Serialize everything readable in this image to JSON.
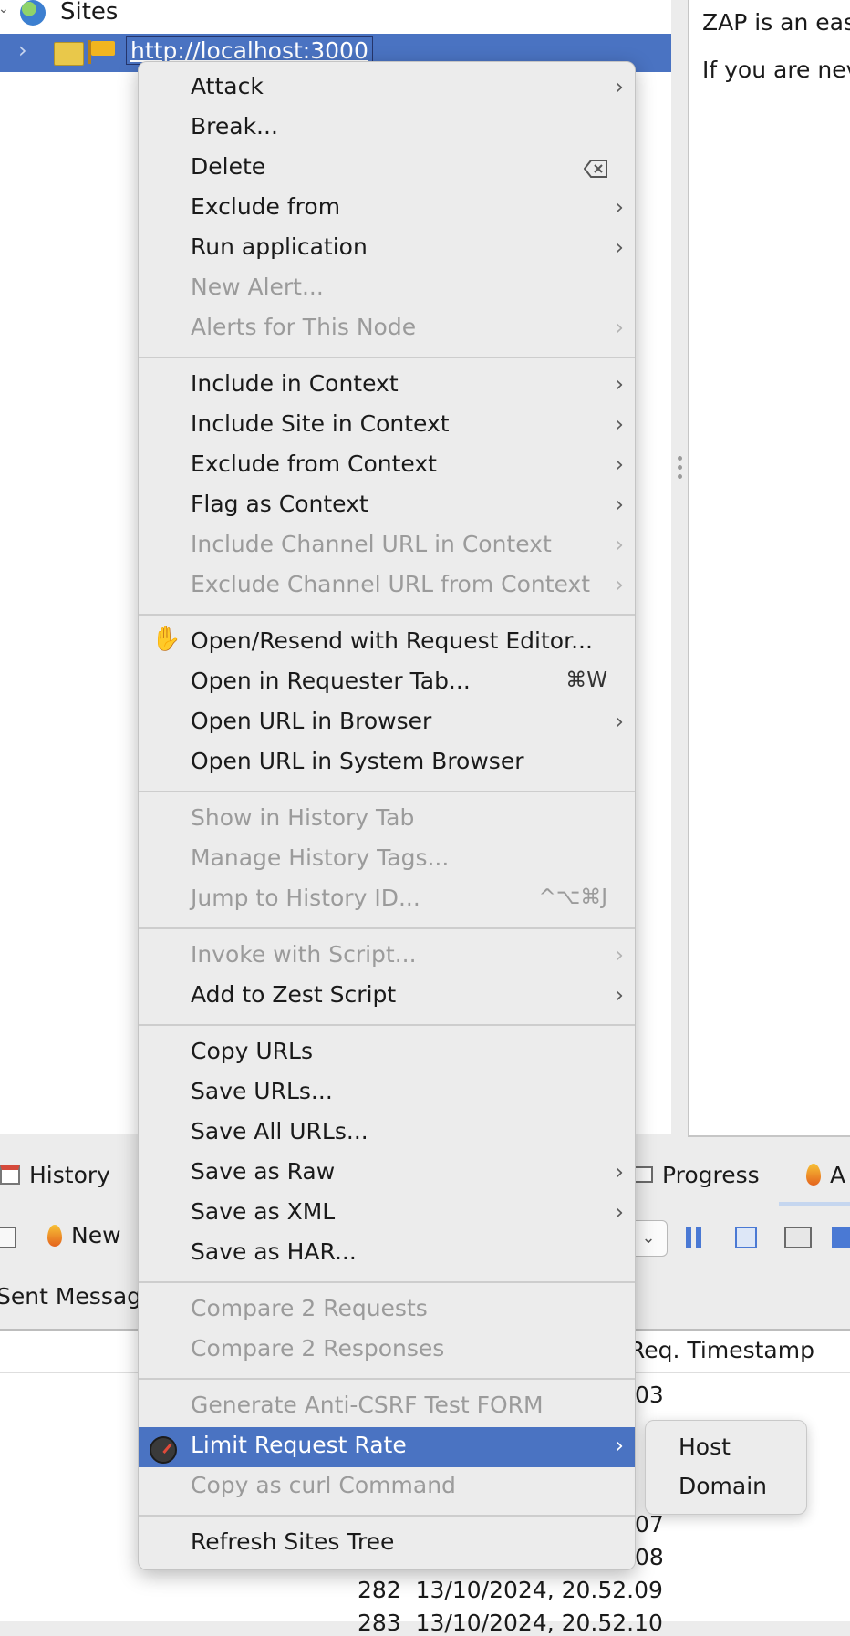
{
  "tree": {
    "sites_label": "Sites",
    "host_url": "http://localhost:3000"
  },
  "info_panel": {
    "line1": "ZAP is an eas",
    "line2": "If you are nev"
  },
  "bottom_tabs": {
    "history": "History",
    "progress": "Progress",
    "alerts_partial": "A"
  },
  "toolbar": {
    "new_label": "New"
  },
  "subtab": {
    "sent_messages": "Sent Messag"
  },
  "table": {
    "col_req_timestamp": "Req. Timestamp",
    "visible_cells": [
      {
        "partial": ".03"
      },
      {
        "partial": ".07"
      },
      {
        "partial": ".08"
      }
    ],
    "row_282": {
      "id": "282",
      "timestamp": "13/10/2024, 20.52.09"
    },
    "row_283": {
      "id": "283",
      "timestamp": "13/10/2024, 20.52.10"
    }
  },
  "context_menu": {
    "items": [
      {
        "label": "Attack",
        "submenu": true,
        "enabled": true
      },
      {
        "label": "Break...",
        "enabled": true
      },
      {
        "label": "Delete",
        "enabled": true
      },
      {
        "label": "Exclude from",
        "submenu": true,
        "enabled": true
      },
      {
        "label": "Run application",
        "submenu": true,
        "enabled": true
      },
      {
        "label": "New Alert...",
        "enabled": false
      },
      {
        "label": "Alerts for This Node",
        "submenu": true,
        "enabled": false
      },
      {
        "label": "Include in Context",
        "submenu": true,
        "enabled": true
      },
      {
        "label": "Include Site in Context",
        "submenu": true,
        "enabled": true
      },
      {
        "label": "Exclude from Context",
        "submenu": true,
        "enabled": true
      },
      {
        "label": "Flag as Context",
        "submenu": true,
        "enabled": true
      },
      {
        "label": "Include Channel URL in Context",
        "submenu": true,
        "enabled": false
      },
      {
        "label": "Exclude Channel URL from Context",
        "submenu": true,
        "enabled": false
      },
      {
        "label": "Open/Resend with Request Editor...",
        "enabled": true
      },
      {
        "label": "Open in Requester Tab...",
        "shortcut": "⌘W",
        "enabled": true
      },
      {
        "label": "Open URL in Browser",
        "submenu": true,
        "enabled": true
      },
      {
        "label": "Open URL in System Browser",
        "enabled": true
      },
      {
        "label": "Show in History Tab",
        "enabled": false
      },
      {
        "label": "Manage History Tags...",
        "enabled": false
      },
      {
        "label": "Jump to History ID...",
        "shortcut": "^⌥⌘J",
        "enabled": false
      },
      {
        "label": "Invoke with Script...",
        "submenu": true,
        "enabled": false
      },
      {
        "label": "Add to Zest Script",
        "submenu": true,
        "enabled": true
      },
      {
        "label": "Copy URLs",
        "enabled": true
      },
      {
        "label": "Save URLs...",
        "enabled": true
      },
      {
        "label": "Save All URLs...",
        "enabled": true
      },
      {
        "label": "Save as Raw",
        "submenu": true,
        "enabled": true
      },
      {
        "label": "Save as XML",
        "submenu": true,
        "enabled": true
      },
      {
        "label": "Save as HAR...",
        "enabled": true
      },
      {
        "label": "Compare 2 Requests",
        "enabled": false
      },
      {
        "label": "Compare 2 Responses",
        "enabled": false
      },
      {
        "label": "Generate Anti-CSRF Test FORM",
        "enabled": false
      },
      {
        "label": "Limit Request Rate",
        "submenu": true,
        "enabled": true,
        "selected": true
      },
      {
        "label": "Copy as curl Command",
        "enabled": false
      },
      {
        "label": "Refresh Sites Tree",
        "enabled": true
      }
    ],
    "submenu_arrow": "›"
  },
  "limit_submenu": {
    "items": [
      "Host",
      "Domain"
    ]
  },
  "colors": {
    "selection": "#4a73c2",
    "menu_bg": "#ececec",
    "disabled_text": "#9b9b9b"
  }
}
